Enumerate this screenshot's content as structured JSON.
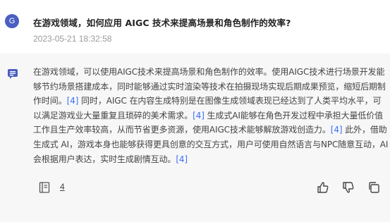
{
  "question": {
    "avatar_letter": "G",
    "text": "在游戏领域，如何应用 AIGC 技术来提高场景和角色制作的效率?",
    "timestamp": "2023-05-21 18:32:58"
  },
  "answer": {
    "segments": [
      {
        "text": "在游戏领域，可以使用AIGC技术来提高场景和角色制作的效率。使用AIGC技术进行场景开发能够节约场景搭建成本，同时能够通过实时渲染等技术在拍摄现场实现后期成果预览，缩短后期制作时间。",
        "cite": false
      },
      {
        "text": "[4]",
        "cite": true
      },
      {
        "text": " 同时，AIGC 在内容生成特别是在图像生成领域表现已经达到了人类平均水平，可以满足游戏业大量重复且琐碎的美术需求。",
        "cite": false
      },
      {
        "text": "[4]",
        "cite": true
      },
      {
        "text": " 生成式AI能够在角色开发过程中承担大量低价值工作且生产效率较高，从而节省更多资源，使用AIGC技术能够解放游戏创造力。",
        "cite": false
      },
      {
        "text": "[4]",
        "cite": true
      },
      {
        "text": " 此外，借助生成式 AI，游戏本身也能够获得更具创意的交互方式，用户可使用自然语言与NPC随意互动，AI会根据用户表达，实时生成剧情互动。",
        "cite": false
      },
      {
        "text": "[4]",
        "cite": true
      }
    ],
    "source_count": "4"
  },
  "icons": {
    "avatar": "user-avatar",
    "bot": "bot-chat-icon",
    "sources": "book-sources-icon",
    "like": "thumbs-up-icon",
    "dislike": "thumbs-down-icon",
    "copy": "copy-icon"
  },
  "colors": {
    "avatar_bg": "#4a5fc1",
    "citation": "#3b6ff5",
    "answer_bg": "#f7f7f8",
    "bot_icon": "#4a5fc1"
  }
}
